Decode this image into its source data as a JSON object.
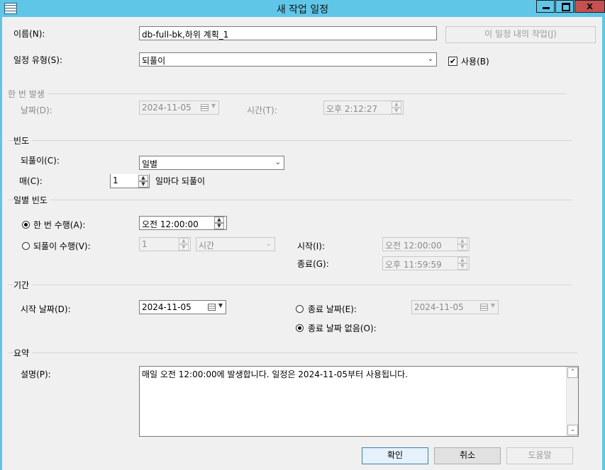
{
  "window": {
    "title": "새 작업 일정",
    "close_label": "x"
  },
  "name": {
    "label": "이름(N):",
    "value": "db-full-bk,하위 계획_1"
  },
  "jobs_button": "이 일정 내의 작업(J)",
  "schedule_type": {
    "label": "일정 유형(S):",
    "value": "되풀이",
    "enabled_label": "사용(B)",
    "enabled_checked": true,
    "check_mark": "✔"
  },
  "one_time": {
    "group_label": "한 번 발생",
    "date_label": "날짜(D):",
    "date_value": "2024-11-05",
    "time_label": "시간(T):",
    "time_value": "오후  2:12:27"
  },
  "frequency": {
    "group_label": "빈도",
    "occurs_label": "되풀이(C):",
    "occurs_value": "일별",
    "every_label": "매(C):",
    "every_value": "1",
    "every_suffix": "일마다 되풀이"
  },
  "daily_frequency": {
    "group_label": "일별 빈도",
    "once_label": "한 번 수행(A):",
    "once_value": "오전 12:00:00",
    "once_selected": true,
    "every_label": "되풀이 수행(V):",
    "every_value": "1",
    "every_unit": "시간",
    "every_selected": false,
    "start_label": "시작(I):",
    "start_value": "오전 12:00:00",
    "end_label": "종료(G):",
    "end_value": "오후 11:59:59"
  },
  "duration": {
    "group_label": "기간",
    "start_label": "시작 날짜(D):",
    "start_value": "2024-11-05",
    "end_date_label": "종료 날짜(E):",
    "end_date_value": "2024-11-05",
    "end_date_selected": false,
    "no_end_label": "종료 날짜 없음(O):",
    "no_end_selected": true
  },
  "summary": {
    "group_label": "요약",
    "desc_label": "설명(P):",
    "desc_value": "매일 오전 12:00:00에 발생합니다. 일정은 2024-11-05부터 사용됩니다."
  },
  "buttons": {
    "ok": "확인",
    "cancel": "취소",
    "help": "도움말"
  }
}
